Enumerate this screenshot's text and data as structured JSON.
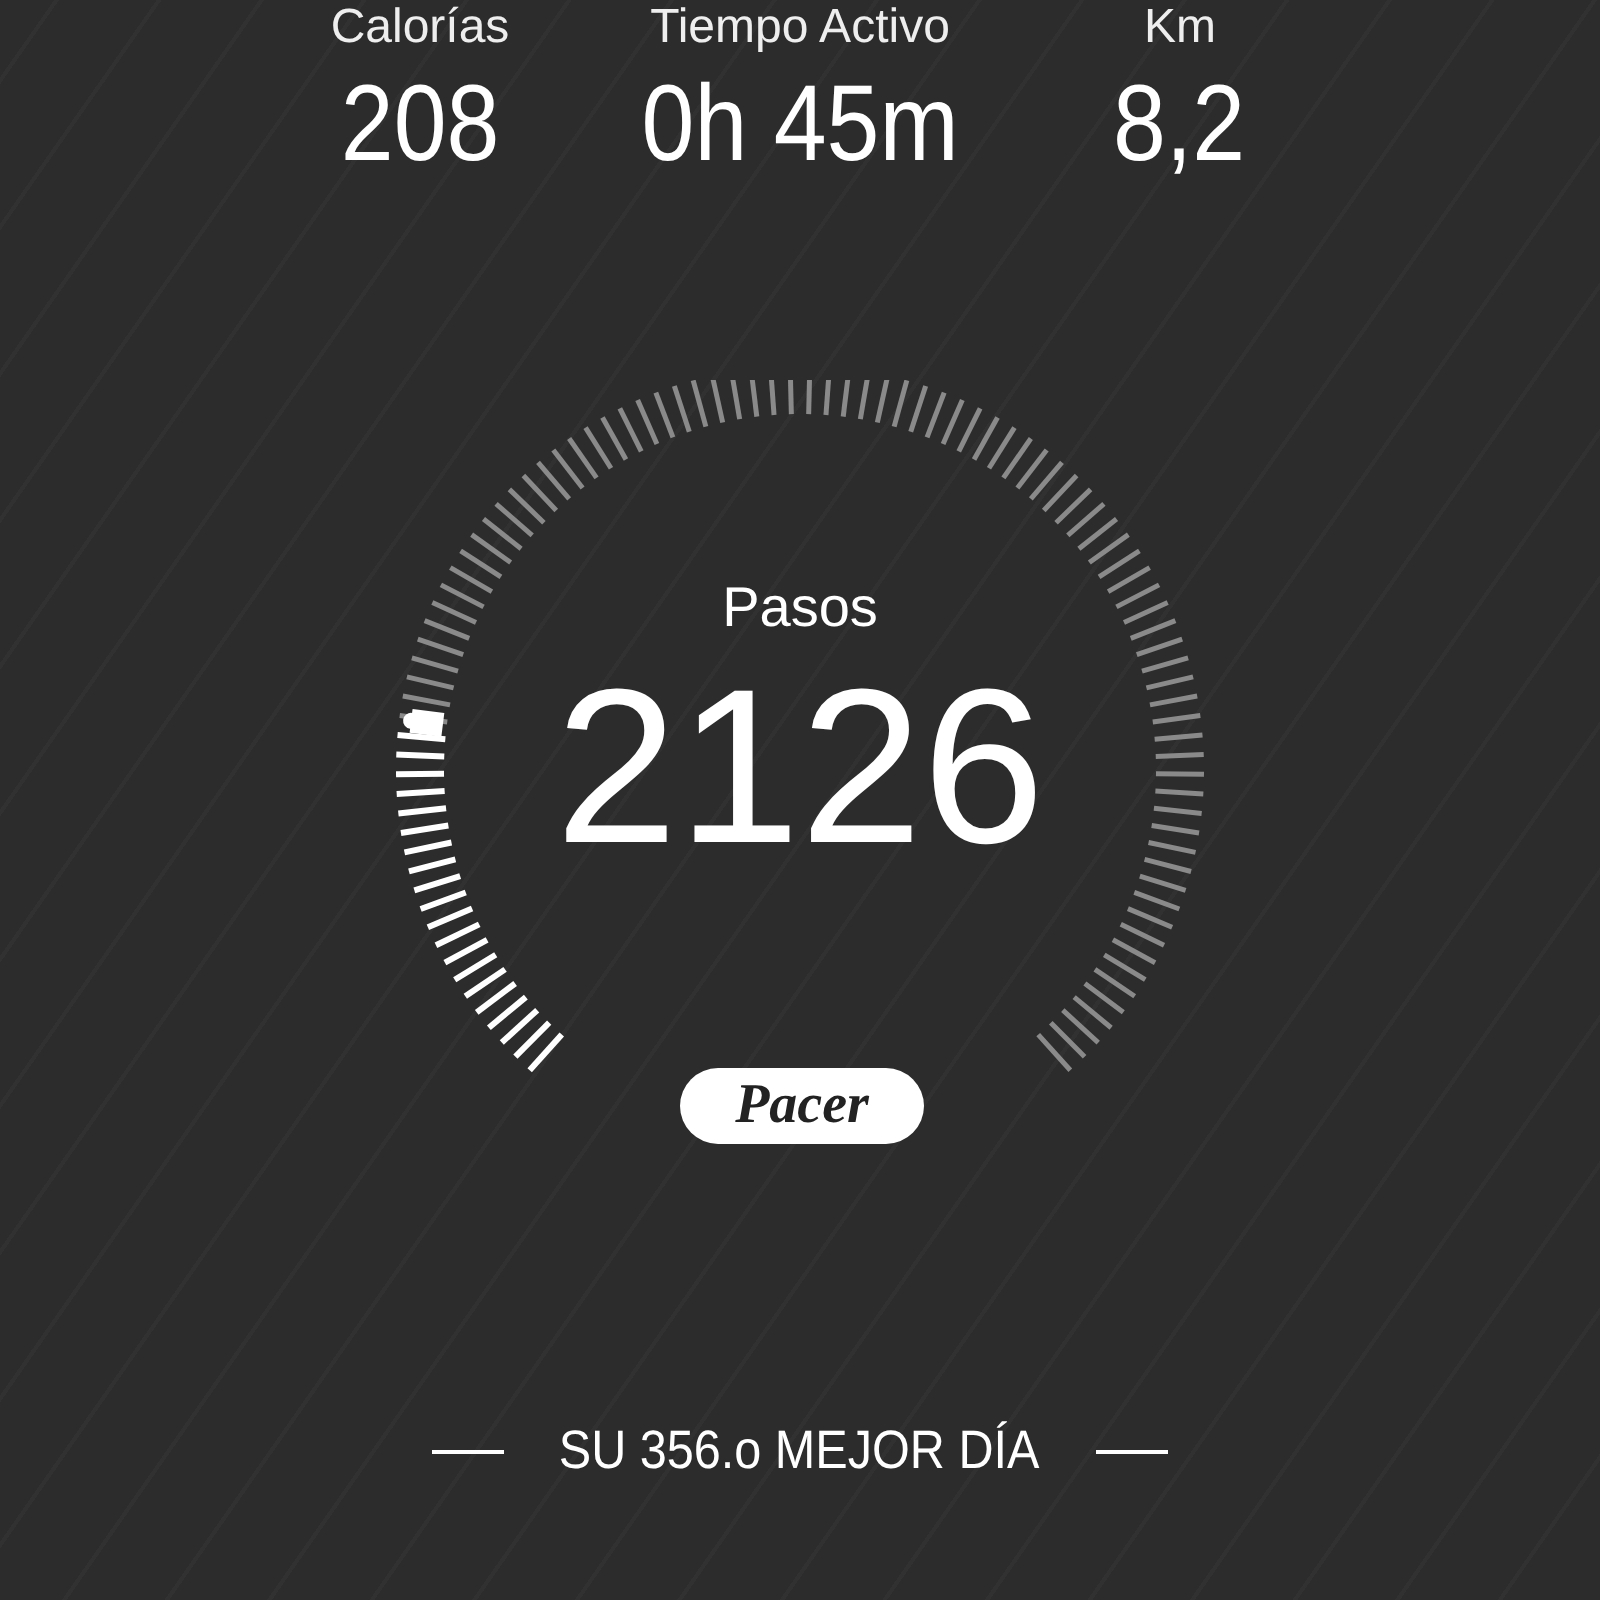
{
  "stats": [
    {
      "label": "Calorías",
      "value": "208"
    },
    {
      "label": "Tiempo Activo",
      "value": "0h 45m"
    },
    {
      "label": "Km",
      "value": "8,2"
    }
  ],
  "gauge": {
    "label": "Pasos",
    "value": "2126"
  },
  "brand": "Pacer",
  "best_day": "SU 356.o MEJOR DÍA"
}
